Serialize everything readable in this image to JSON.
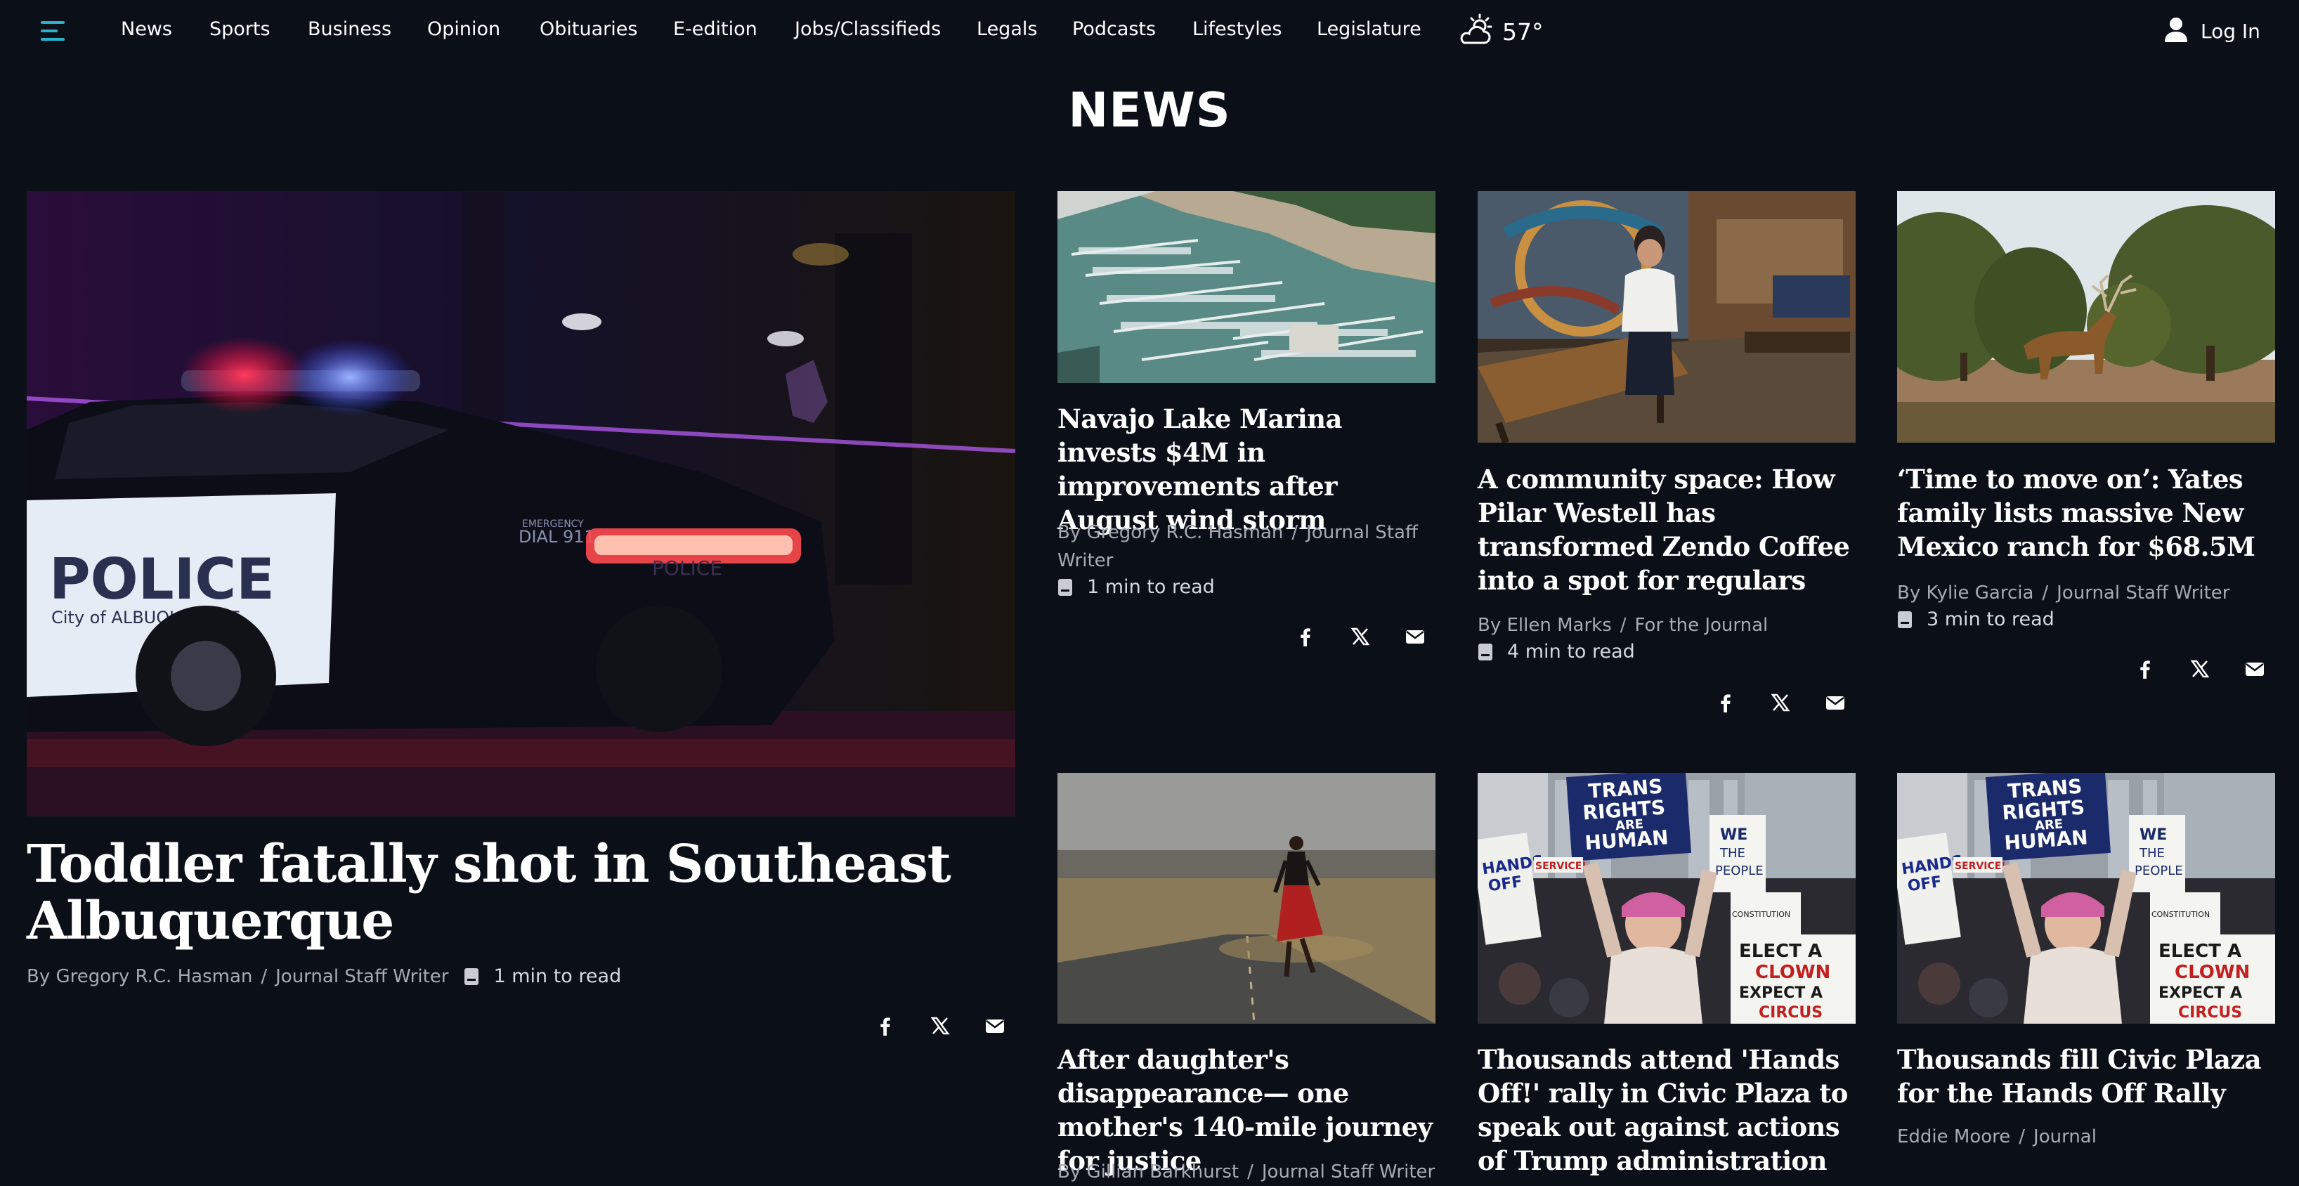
{
  "nav": {
    "links": [
      "News",
      "Sports",
      "Business",
      "Opinion",
      "Obituaries",
      "E-edition",
      "Jobs/Classifieds",
      "Legals",
      "Podcasts",
      "Lifestyles",
      "Legislature"
    ],
    "weather": {
      "temperature": "57°",
      "icon": "partly-sunny-icon"
    },
    "login_label": "Log In"
  },
  "section": {
    "title": "NEWS"
  },
  "colors": {
    "background": "#0b0f17",
    "accent": "#2ab0c8",
    "meta_text": "#a7acb4"
  },
  "hero": {
    "headline": "Toddler fatally shot in Southeast Albuquerque",
    "author": "By Gregory R.C. Hasman",
    "role": "Journal Staff Writer",
    "read_time": "1 min to read",
    "image_text": {
      "police": "POLICE",
      "city": "City of ALBUQUERQUE",
      "emergency": "EMERGENCY",
      "dial": "DIAL 911",
      "rear": "POLICE"
    }
  },
  "stories": [
    {
      "headline": "Navajo Lake Marina invests $4M in improvements after August wind storm",
      "author": "By Gregory R.C. Hasman",
      "role": "Journal Staff Writer",
      "read_time": "1 min to read"
    },
    {
      "headline": "A community space: How Pilar Westell has transformed Zendo Coffee into a spot for regulars",
      "author": "By Ellen Marks",
      "role": "For the Journal",
      "read_time": "4 min to read"
    },
    {
      "headline": "‘Time to move on’: Yates family lists massive New Mexico ranch for $68.5M",
      "author": "By Kylie Garcia",
      "role": "Journal Staff Writer",
      "read_time": "3 min to read"
    },
    {
      "headline": "After daughter's disappearance— one mother's 140-mile journey for justice",
      "author": "By Gillian Barkhurst",
      "role": "Journal Staff Writer"
    },
    {
      "headline": "Thousands attend 'Hands Off!' rally in Civic Plaza to speak out against actions of Trump administration"
    },
    {
      "headline": "Thousands fill Civic Plaza for the Hands Off Rally",
      "author": "Eddie Moore",
      "role": "Journal"
    }
  ],
  "protest_signs": {
    "main": [
      "TRANS",
      "RIGHTS",
      "ARE",
      "HUMAN",
      "RIGHTS"
    ],
    "left": [
      "HANDS",
      "OFF"
    ],
    "service": "SERVICE!",
    "we": [
      "WE",
      "THE",
      "PEOPLE"
    ],
    "const": "CONSTITUTION",
    "elect": [
      "ELECT A",
      "CLOWN",
      "EXPECT A",
      "CIRCUS"
    ]
  }
}
